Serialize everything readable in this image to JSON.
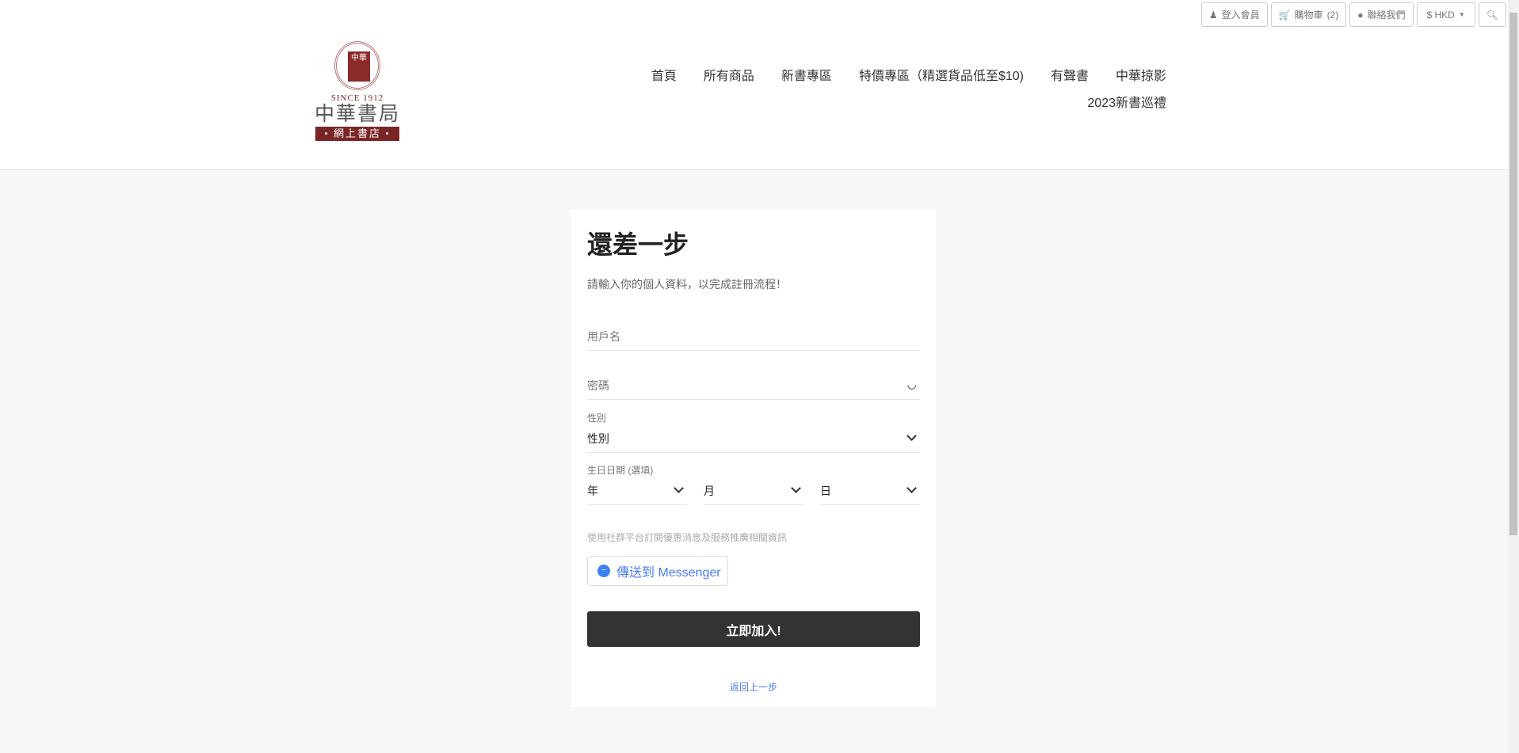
{
  "topbar": {
    "login": "登入會員",
    "cart": "購物車",
    "cart_count": "(2)",
    "contact": "聯絡我們",
    "currency": "$ HKD"
  },
  "logo": {
    "since": "SINCE 1912",
    "name": "中華書局",
    "sub": "• 網上書店 •",
    "seal": "中華"
  },
  "nav": [
    "首頁",
    "所有商品",
    "新書專區",
    "特價專區（精選貨品低至$10)",
    "有聲書",
    "中華掠影",
    "2023新書巡禮"
  ],
  "form": {
    "title": "還差一步",
    "subtitle": "請輸入你的個人資料，以完成註冊流程！",
    "username_placeholder": "用戶名",
    "password_placeholder": "密碼",
    "gender_label": "性別",
    "gender_value": "性別",
    "birthday_label": "生日日期 (選填)",
    "year": "年",
    "month": "月",
    "day": "日",
    "social_text": "使用社群平台訂閱優惠消息及服務推廣相關資訊",
    "messenger": "傳送到 Messenger",
    "submit": "立即加入!",
    "back": "返回上一步"
  }
}
